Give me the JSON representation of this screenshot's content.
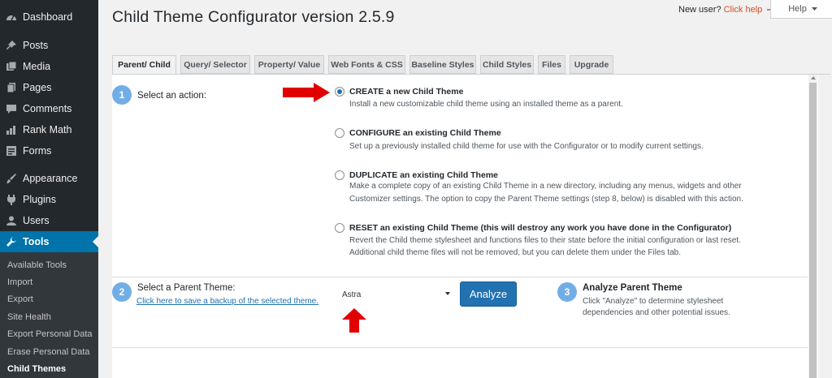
{
  "sidebar": {
    "items": [
      {
        "label": "Dashboard",
        "icon": "dashboard-icon"
      },
      {
        "label": "Posts",
        "icon": "pin-icon"
      },
      {
        "label": "Media",
        "icon": "media-icon"
      },
      {
        "label": "Pages",
        "icon": "pages-icon"
      },
      {
        "label": "Comments",
        "icon": "comment-icon"
      },
      {
        "label": "Rank Math",
        "icon": "chart-icon"
      },
      {
        "label": "Forms",
        "icon": "forms-icon"
      },
      {
        "label": "Appearance",
        "icon": "brush-icon"
      },
      {
        "label": "Plugins",
        "icon": "plugin-icon"
      },
      {
        "label": "Users",
        "icon": "user-icon"
      },
      {
        "label": "Tools",
        "icon": "wrench-icon"
      }
    ],
    "submenu": [
      "Available Tools",
      "Import",
      "Export",
      "Site Health",
      "Export Personal Data",
      "Erase Personal Data",
      "Child Themes"
    ]
  },
  "header": {
    "title": "Child Theme Configurator version 2.5.9",
    "new_user_text": "New user?",
    "click_help": "Click help",
    "help_label": "Help"
  },
  "tabs": [
    "Parent/ Child",
    "Query/ Selector",
    "Property/ Value",
    "Web Fonts & CSS",
    "Baseline Styles",
    "Child Styles",
    "Files",
    "Upgrade"
  ],
  "step1": {
    "number": "1",
    "label": "Select an action:",
    "options": [
      {
        "title": "CREATE a new Child Theme",
        "desc": [
          "Install a new customizable child theme using an installed theme as a parent."
        ]
      },
      {
        "title": "CONFIGURE an existing Child Theme",
        "desc": [
          "Set up a previously installed child theme for use with the Configurator or to modify current settings."
        ]
      },
      {
        "title": "DUPLICATE an existing Child Theme",
        "desc": [
          "Make a complete copy of an existing Child Theme in a new directory, including any menus, widgets and other",
          "Customizer settings. The option to copy the Parent Theme settings (step 8, below) is disabled with this action."
        ]
      },
      {
        "title": "RESET an existing Child Theme (this will destroy any work you have done in the Configurator)",
        "desc": [
          "Revert the Child theme stylesheet and functions files to their state before the initial configuration or last reset.",
          "Additional child theme files will not be removed, but you can delete them under the Files tab."
        ]
      }
    ]
  },
  "step2": {
    "number": "2",
    "label": "Select a Parent Theme:",
    "link": "Click here to save a backup of the selected theme.",
    "selected_theme": "Astra",
    "analyze_label": "Analyze"
  },
  "step3": {
    "number": "3",
    "label": "Analyze Parent Theme",
    "desc": [
      "Click \"Analyze\" to determine stylesheet",
      "dependencies and other potential issues."
    ]
  },
  "colors": {
    "sidebar_bg": "#23282d",
    "active_blue": "#0073aa",
    "step_circle": "#72aee6",
    "button_blue": "#2271b1",
    "annotation_red": "#e00000",
    "help_link": "#d54e21"
  }
}
